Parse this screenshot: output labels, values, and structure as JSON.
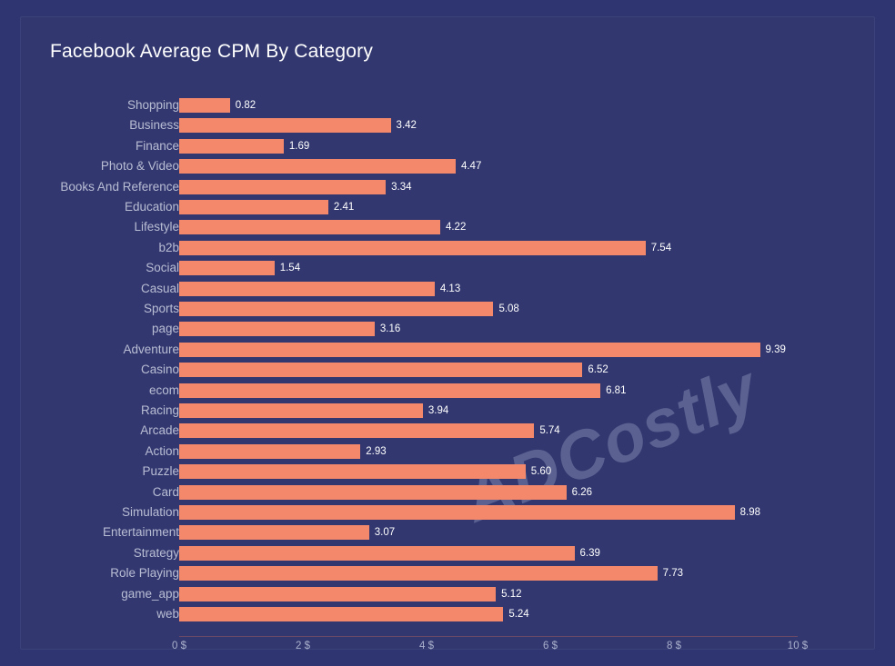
{
  "card": {
    "background": "#32386f",
    "border_color": "#3b4179"
  },
  "page": {
    "background": "#2f3570"
  },
  "watermark": {
    "text": "ADCostly",
    "color": "rgba(190,196,224,0.30)"
  },
  "chart_data": {
    "type": "bar",
    "orientation": "horizontal",
    "title": "Facebook Average CPM By Category",
    "xlabel": "",
    "ylabel": "",
    "xlim": [
      0,
      10
    ],
    "grid": false,
    "legend": null,
    "bar_color": "#f4886a",
    "label_color": "#b9bdd4",
    "value_label_color": "#ffffff",
    "axis_tick_labels": [
      "0 $",
      "2 $",
      "4 $",
      "6 $",
      "8 $",
      "10 $"
    ],
    "axis_tick_values": [
      0,
      2,
      4,
      6,
      8,
      10
    ],
    "categories": [
      "Shopping",
      "Business",
      "Finance",
      "Photo & Video",
      "Books And Reference",
      "Education",
      "Lifestyle",
      "b2b",
      "Social",
      "Casual",
      "Sports",
      "page",
      "Adventure",
      "Casino",
      "ecom",
      "Racing",
      "Arcade",
      "Action",
      "Puzzle",
      "Card",
      "Simulation",
      "Entertainment",
      "Strategy",
      "Role Playing",
      "game_app",
      "web"
    ],
    "values": [
      0.82,
      3.42,
      1.69,
      4.47,
      3.34,
      2.41,
      4.22,
      7.54,
      1.54,
      4.13,
      5.08,
      3.16,
      9.39,
      6.52,
      6.81,
      3.94,
      5.74,
      2.93,
      5.6,
      6.26,
      8.98,
      3.07,
      6.39,
      7.73,
      5.12,
      5.24
    ],
    "value_labels": [
      "0.82",
      "3.42",
      "1.69",
      "4.47",
      "3.34",
      "2.41",
      "4.22",
      "7.54",
      "1.54",
      "4.13",
      "5.08",
      "3.16",
      "9.39",
      "6.52",
      "6.81",
      "3.94",
      "5.74",
      "2.93",
      "5.60",
      "6.26",
      "8.98",
      "3.07",
      "6.39",
      "7.73",
      "5.12",
      "5.24"
    ]
  }
}
